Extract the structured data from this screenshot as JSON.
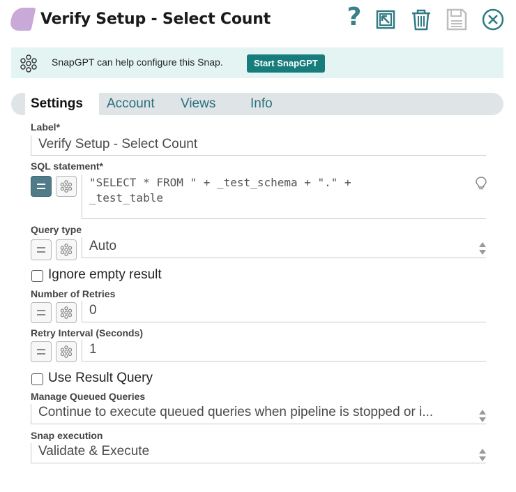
{
  "header": {
    "title": "Verify Setup - Select Count",
    "help_glyph": "?",
    "accent_color": "#2f7a83",
    "snap_color": "#c9a9d8",
    "icons": [
      "help-icon",
      "jump-icon",
      "trash-icon",
      "save-icon",
      "close-icon"
    ]
  },
  "banner": {
    "text": "SnapGPT can help configure this Snap.",
    "button_label": "Start SnapGPT",
    "bg_color": "#e3f4f3",
    "button_color": "#177d7c"
  },
  "tabs": [
    {
      "label": "Settings",
      "active": true
    },
    {
      "label": "Account",
      "active": false
    },
    {
      "label": "Views",
      "active": false
    },
    {
      "label": "Info",
      "active": false
    }
  ],
  "form": {
    "label": {
      "label": "Label*",
      "value": "Verify Setup - Select Count"
    },
    "sql": {
      "label": "SQL statement*",
      "value": "\"SELECT * FROM \" + _test_schema + \".\" +\n_test_table",
      "expression_enabled": true
    },
    "query_type": {
      "label": "Query type",
      "value": "Auto"
    },
    "ignore_empty": {
      "label": "Ignore empty result",
      "checked": false
    },
    "retries": {
      "label": "Number of Retries",
      "value": "0"
    },
    "retry_interval": {
      "label": "Retry Interval (Seconds)",
      "value": "1"
    },
    "use_result_query": {
      "label": "Use Result Query",
      "checked": false
    },
    "manage_queued": {
      "label": "Manage Queued Queries",
      "value": "Continue to execute queued queries when pipeline is stopped or i..."
    },
    "snap_execution": {
      "label": "Snap execution",
      "value": "Validate & Execute"
    }
  }
}
